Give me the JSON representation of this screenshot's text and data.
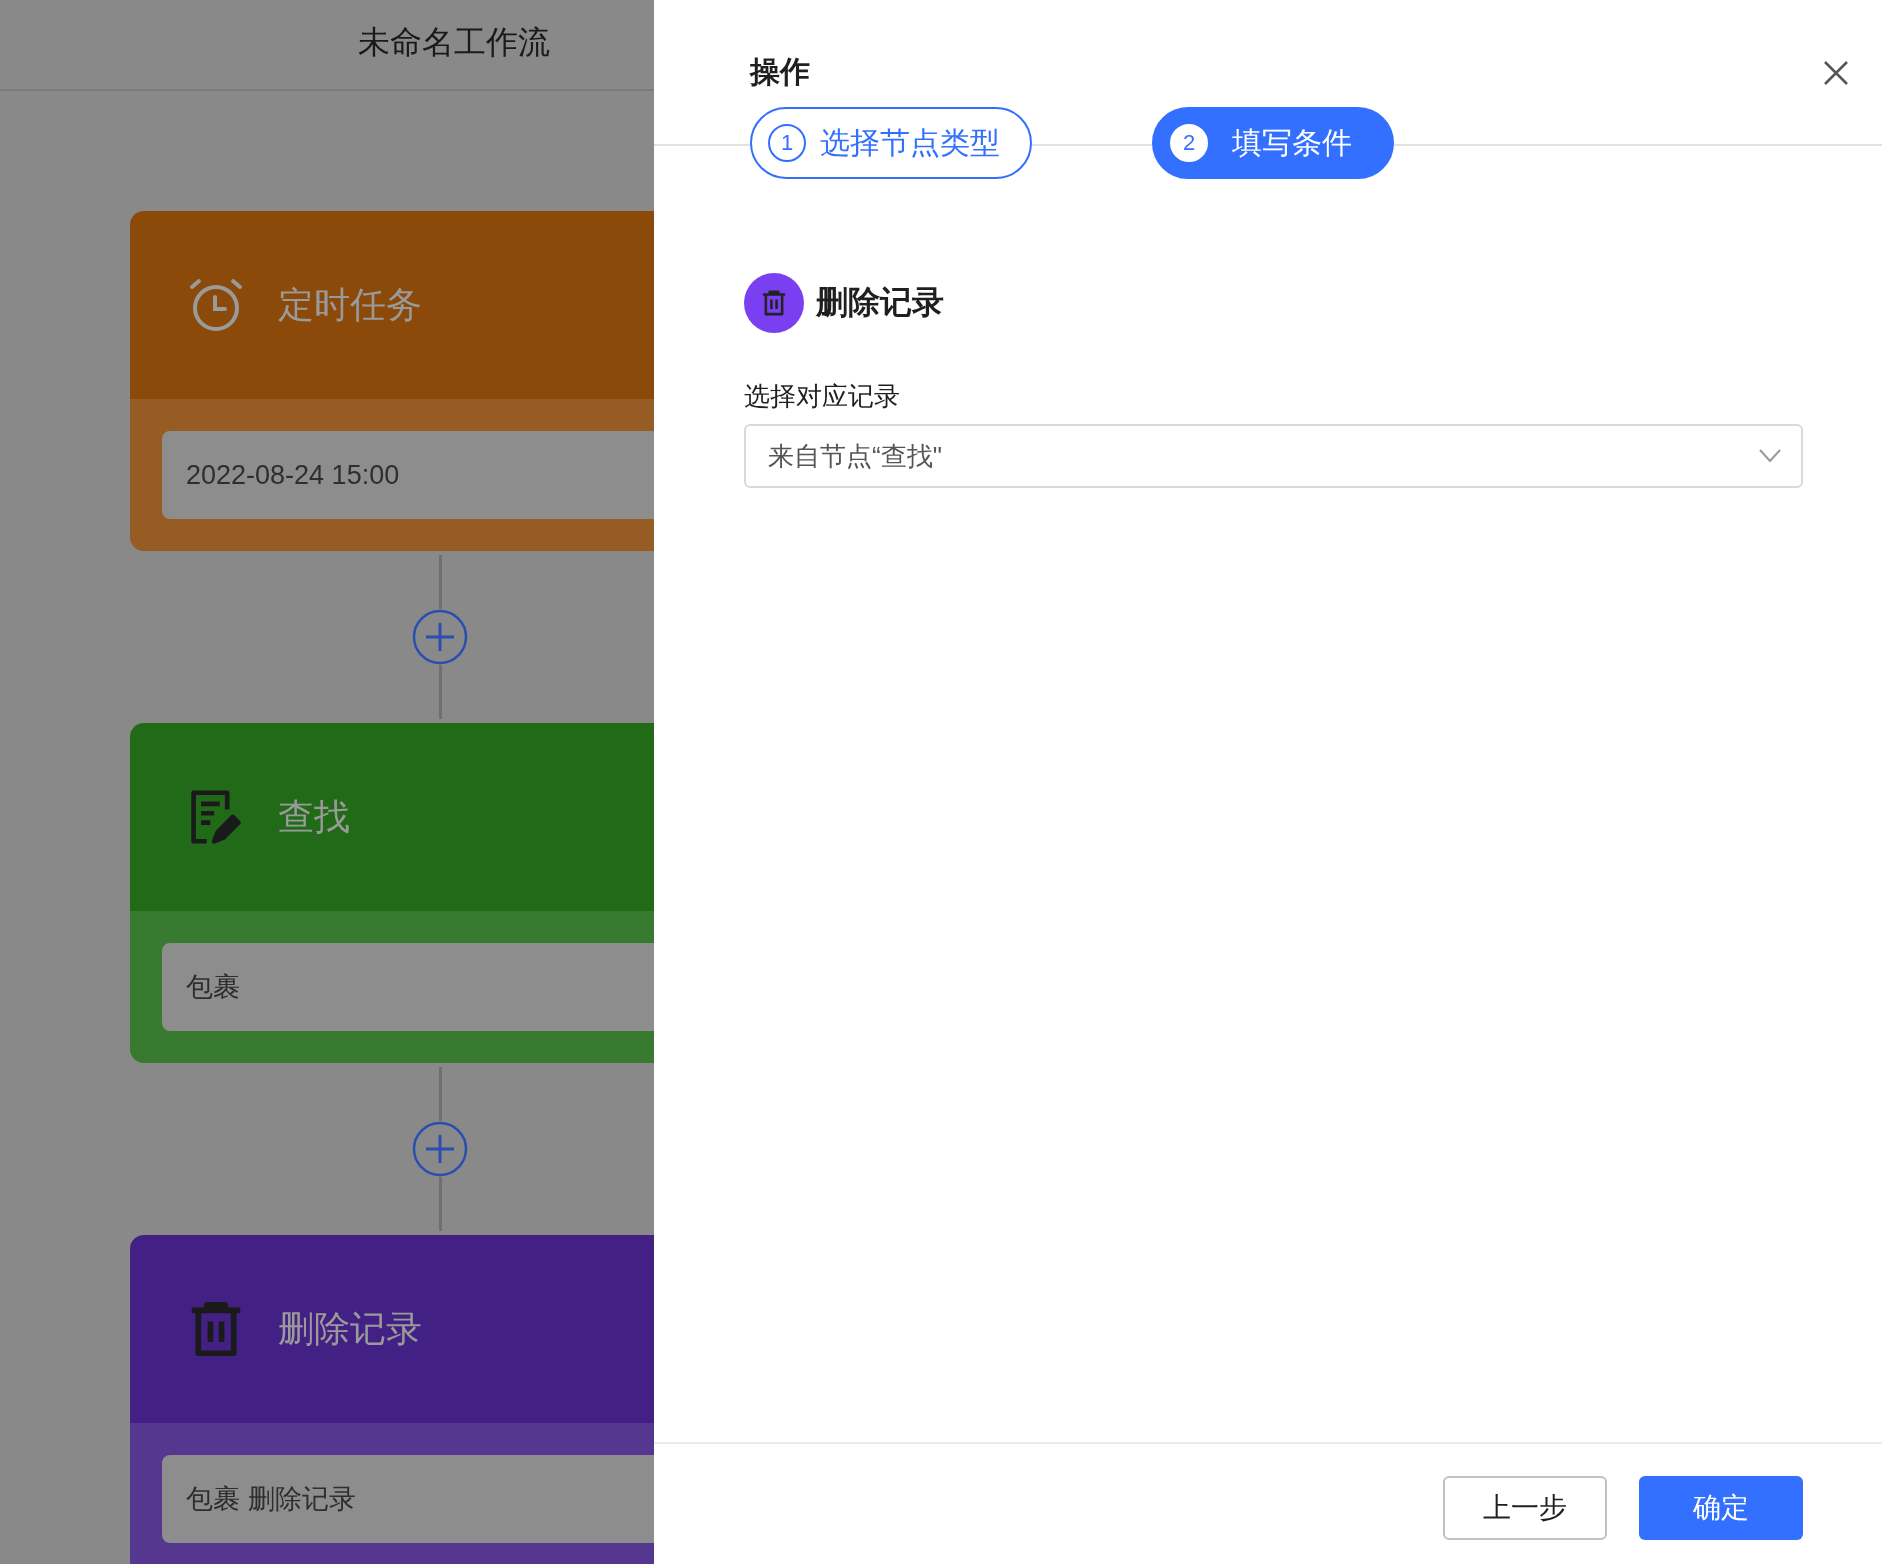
{
  "canvas": {
    "title": "未命名工作流",
    "nodes": [
      {
        "kind": "timer",
        "title": "定时任务",
        "value": "2022-08-24 15:00",
        "color": "#8b4a0a"
      },
      {
        "kind": "find",
        "title": "查找",
        "value": "包裹",
        "color": "#216b18"
      },
      {
        "kind": "delete",
        "title": "删除记录",
        "value": "包裹 删除记录",
        "color": "#432083"
      }
    ]
  },
  "drawer": {
    "title": "操作",
    "steps": [
      {
        "number": "1",
        "label": "选择节点类型",
        "selected": false
      },
      {
        "number": "2",
        "label": "填写条件",
        "selected": true
      }
    ],
    "node": {
      "kind": "delete",
      "title": "删除记录"
    },
    "field": {
      "label": "选择对应记录",
      "value": "来自节点“查找\""
    },
    "buttons": [
      {
        "label": "上一步",
        "kind": "secondary"
      },
      {
        "label": "确定",
        "kind": "primary"
      }
    ]
  }
}
